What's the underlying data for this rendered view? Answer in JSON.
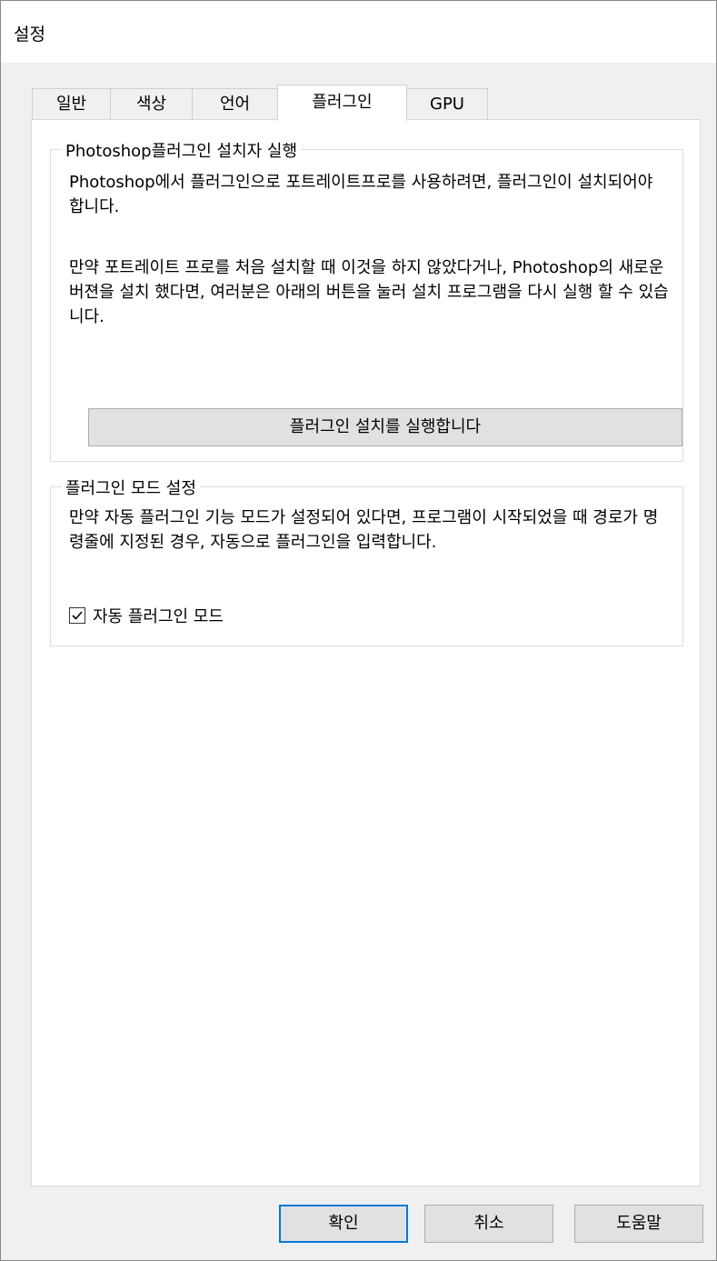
{
  "window": {
    "title": "설정"
  },
  "tabs": [
    {
      "label": "일반"
    },
    {
      "label": "색상"
    },
    {
      "label": "언어"
    },
    {
      "label": "플러그인"
    },
    {
      "label": "GPU"
    }
  ],
  "active_tab": "플러그인",
  "installer_group": {
    "legend": "Photoshop플러그인 설치자 실행",
    "para1": "Photoshop에서 플러그인으로 포트레이트프로를 사용하려면, 플러그인이 설치되어야 합니다.",
    "para2": "만약 포트레이트 프로를 처음 설치할 때 이것을 하지 않았다거나, Photoshop의 새로운 버젼을 설치 했다면, 여러분은 아래의 버튼을 눌러 설치 프로그램을 다시 실행 할 수 있습니다.",
    "run_button": "플러그인 설치를 실행합니다"
  },
  "mode_group": {
    "legend": "플러그인 모드 설정",
    "description": "만약 자동 플러그인 기능 모드가 설정되어 있다면, 프로그램이 시작되었을 때 경로가 명령줄에 지정된 경우, 자동으로 플러그인을 입력합니다.",
    "checkbox_label": "자동 플러그인 모드",
    "checkbox_checked": true
  },
  "footer": {
    "ok": "확인",
    "cancel": "취소",
    "help": "도움말"
  }
}
